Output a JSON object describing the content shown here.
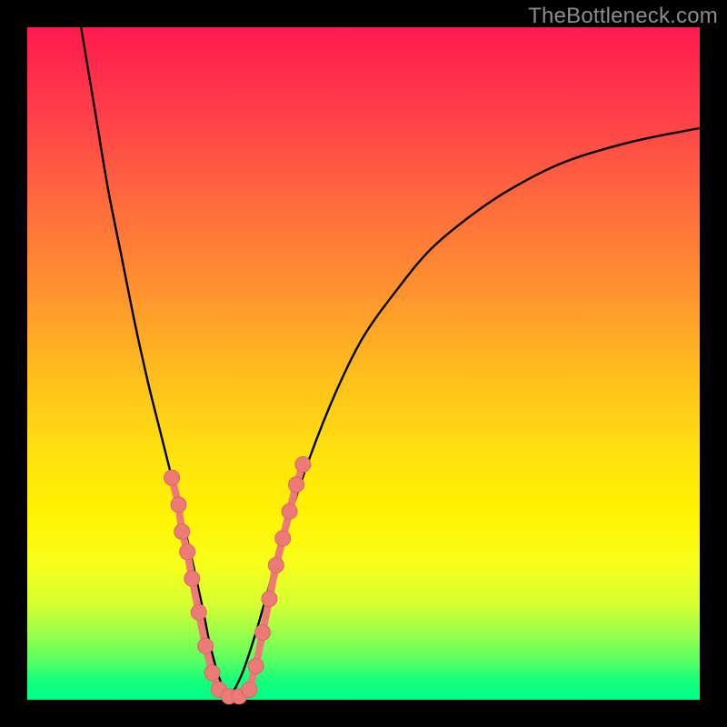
{
  "watermark": "TheBottleneck.com",
  "colors": {
    "frame": "#000000",
    "watermark": "#8c8c8c",
    "curve": "#000000",
    "dot_fill": "#ec7b77",
    "dot_stroke": "#d86862",
    "gradient_stops": [
      "#ff1a4d",
      "#ff3c4a",
      "#ff6a3d",
      "#ff8f30",
      "#ffb81f",
      "#ffe10f",
      "#fff200",
      "#f7ff1a",
      "#d4ff33",
      "#9bff4a",
      "#5cff60",
      "#17ff7a",
      "#00ff88"
    ]
  },
  "chart_data": {
    "type": "line",
    "title": "",
    "xlabel": "",
    "ylabel": "",
    "xlim": [
      0,
      100
    ],
    "ylim": [
      0,
      100
    ],
    "series": [
      {
        "name": "bottleneck-curve-left",
        "x": [
          8,
          10,
          12,
          14,
          16,
          18,
          20,
          22,
          24,
          26,
          27,
          28,
          29,
          30
        ],
        "y": [
          100,
          88,
          76,
          66,
          56,
          47,
          39,
          31,
          23,
          14,
          9,
          5,
          2,
          0
        ]
      },
      {
        "name": "bottleneck-curve-right",
        "x": [
          30,
          32,
          34,
          36,
          38,
          42,
          46,
          50,
          55,
          60,
          66,
          72,
          80,
          90,
          100
        ],
        "y": [
          0,
          4,
          10,
          17,
          24,
          36,
          46,
          54,
          61,
          67,
          72,
          76,
          80,
          83,
          85
        ]
      }
    ],
    "scatter": {
      "name": "highlighted-samples",
      "points": [
        {
          "x": 21.5,
          "y": 33
        },
        {
          "x": 22.5,
          "y": 29
        },
        {
          "x": 23.0,
          "y": 25
        },
        {
          "x": 23.8,
          "y": 22
        },
        {
          "x": 24.5,
          "y": 18
        },
        {
          "x": 25.5,
          "y": 13
        },
        {
          "x": 26.5,
          "y": 8
        },
        {
          "x": 27.5,
          "y": 4
        },
        {
          "x": 28.5,
          "y": 1.5
        },
        {
          "x": 30.0,
          "y": 0.5
        },
        {
          "x": 31.5,
          "y": 0.5
        },
        {
          "x": 33.0,
          "y": 1.5
        },
        {
          "x": 34.0,
          "y": 5
        },
        {
          "x": 35.0,
          "y": 10
        },
        {
          "x": 36.0,
          "y": 15
        },
        {
          "x": 37.0,
          "y": 20
        },
        {
          "x": 38.0,
          "y": 24
        },
        {
          "x": 39.0,
          "y": 28
        },
        {
          "x": 40.0,
          "y": 32
        },
        {
          "x": 41.0,
          "y": 35
        }
      ]
    }
  }
}
